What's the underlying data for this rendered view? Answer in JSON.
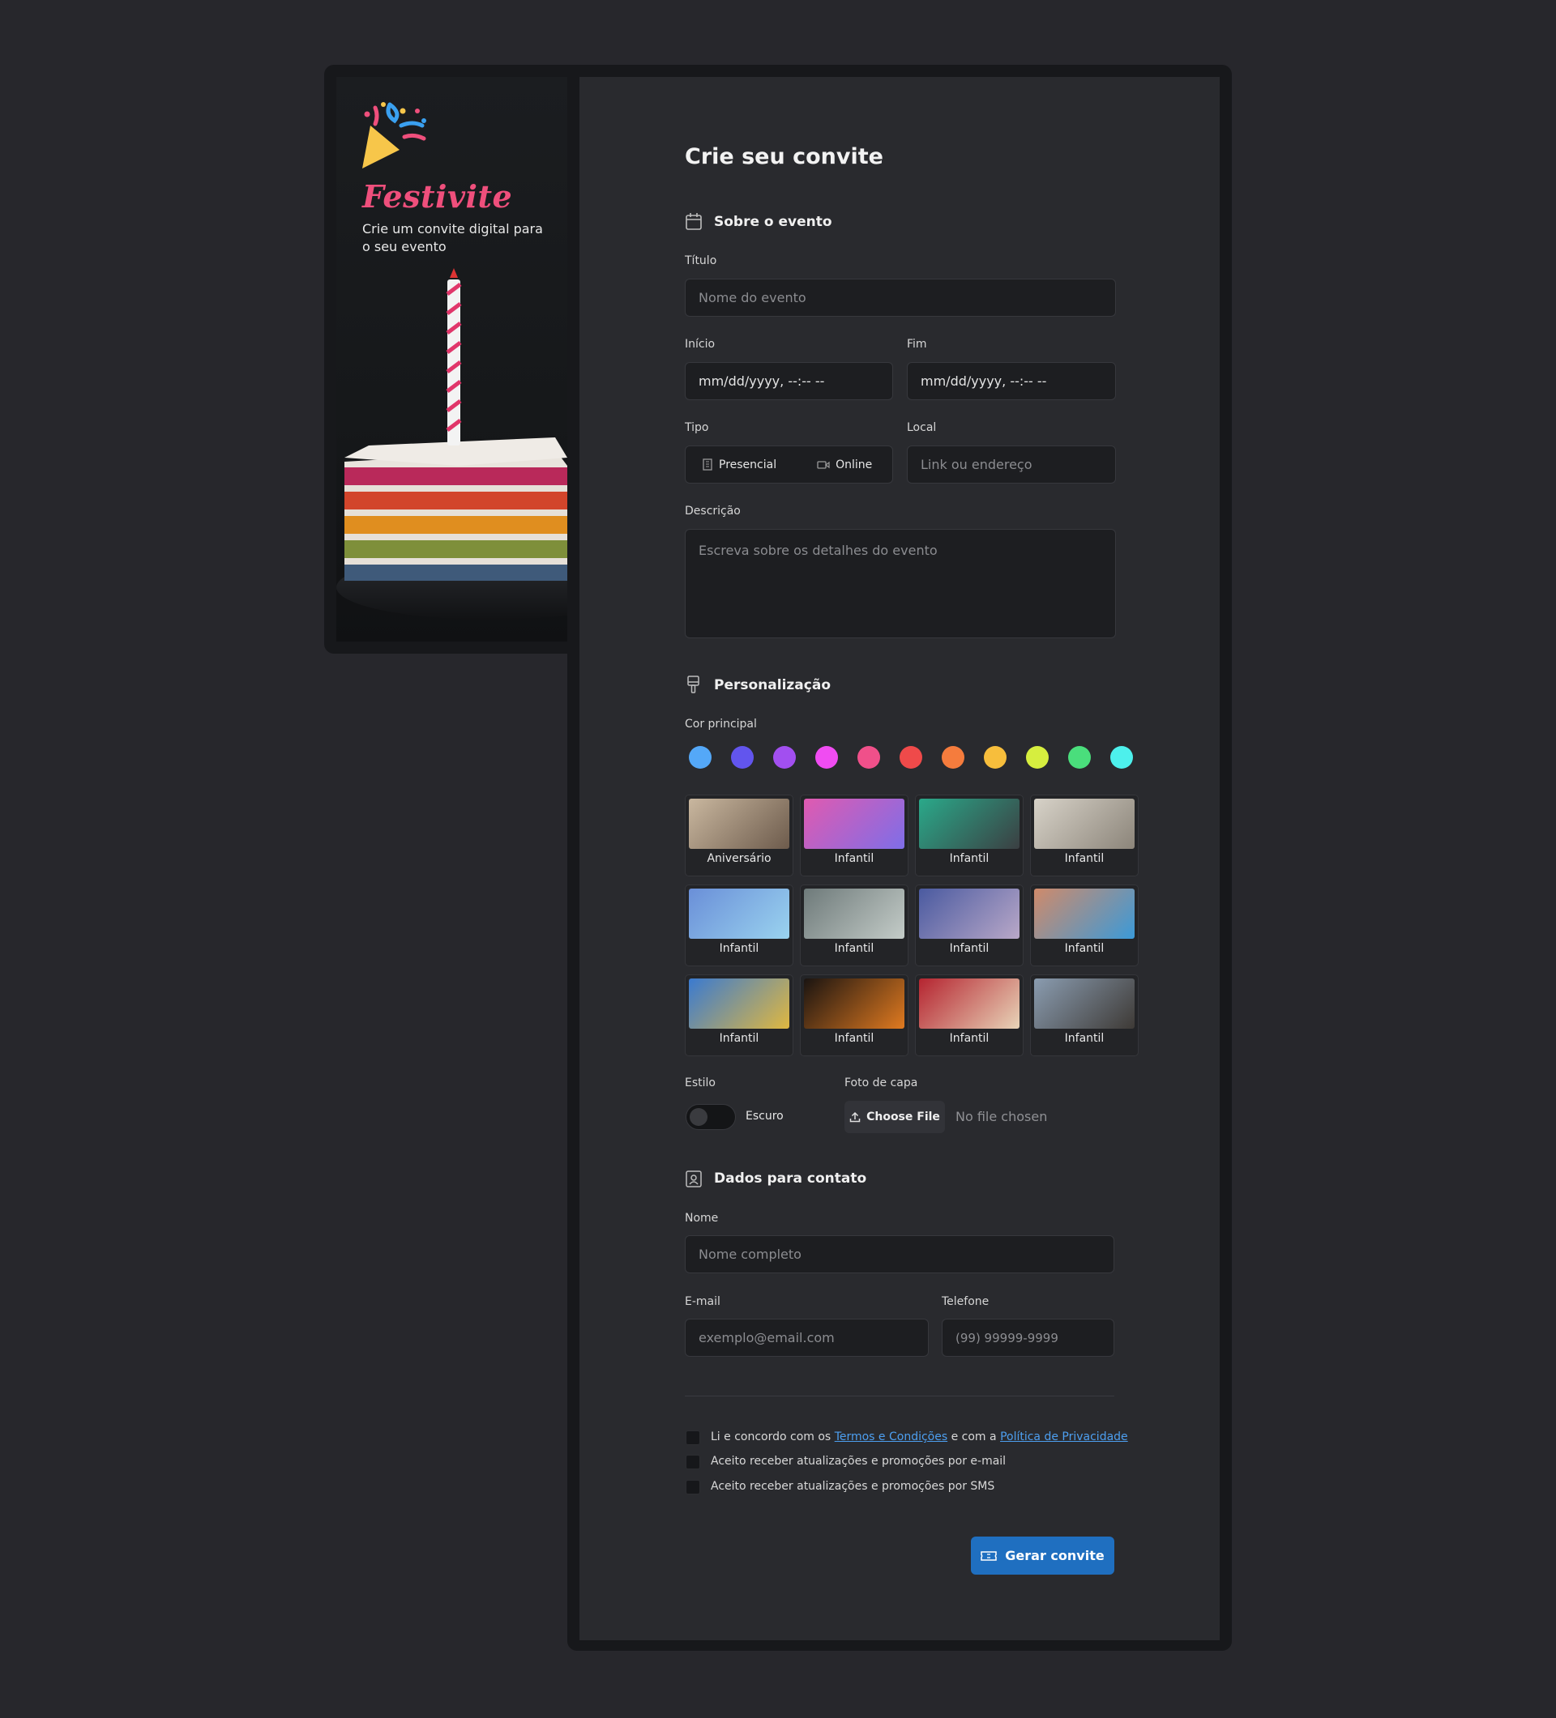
{
  "brand": {
    "name": "Festivite",
    "tagline": "Crie um convite digital para o seu evento"
  },
  "form": {
    "title": "Crie seu convite",
    "section_event": "Sobre o evento",
    "title_label": "Título",
    "title_placeholder": "Nome do evento",
    "start_label": "Início",
    "start_value": "mm/dd/yyyy, --:-- --",
    "end_label": "Fim",
    "end_value": "mm/dd/yyyy, --:-- --",
    "type_label": "Tipo",
    "type_options": [
      "Presencial",
      "Online"
    ],
    "location_label": "Local",
    "location_placeholder": "Link ou endereço",
    "description_label": "Descrição",
    "description_placeholder": "Escreva sobre os detalhes do evento",
    "section_custom": "Personalização",
    "color_label": "Cor principal",
    "colors": [
      "#54a8f8",
      "#6255ee",
      "#a24ff0",
      "#f04cf2",
      "#f0508a",
      "#ef4a4a",
      "#f57c3d",
      "#f7be3c",
      "#d6ee3f",
      "#4ade7c",
      "#4df0ec"
    ],
    "themes": [
      "Aniversário",
      "Infantil",
      "Infantil",
      "Infantil",
      "Infantil",
      "Infantil",
      "Infantil",
      "Infantil",
      "Infantil",
      "Infantil",
      "Infantil",
      "Infantil"
    ],
    "style_label": "Estilo",
    "style_value": "Escuro",
    "cover_label": "Foto de capa",
    "choose_file": "Choose File",
    "no_file": "No file chosen",
    "section_contact": "Dados para contato",
    "name_label": "Nome",
    "name_placeholder": "Nome completo",
    "email_label": "E-mail",
    "email_placeholder": "exemplo@email.com",
    "phone_label": "Telefone",
    "phone_placeholder": "(99) 99999-9999",
    "terms_prefix": "Li e concordo com os ",
    "terms_link": "Termos e Condições",
    "terms_middle": " e com a ",
    "privacy_link": "Política de Privacidade",
    "consent_email": "Aceito receber atualizações e promoções por e-mail",
    "consent_sms": "Aceito receber atualizações e promoções por SMS",
    "submit": "Gerar convite"
  }
}
